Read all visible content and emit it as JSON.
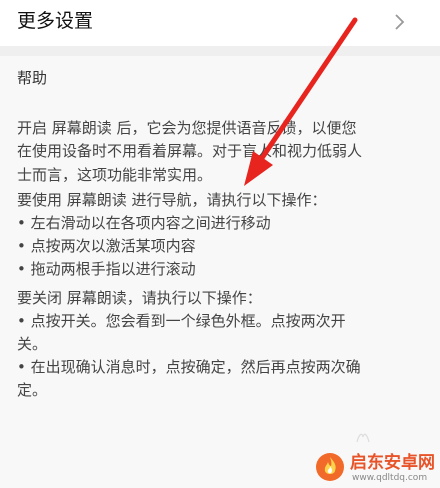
{
  "header": {
    "title": "更多设置",
    "chevron_icon": "chevron-right-icon"
  },
  "help": {
    "title": "帮助",
    "intro_lines": [
      "开启 屏幕朗读 后，它会为您提供语音反馈，以便您",
      "在使用设备时不用看着屏幕。对于盲人和视力低弱人",
      "士而言，这项功能非常实用。"
    ],
    "usage_heading": "要使用 屏幕朗读 进行导航，请执行以下操作：",
    "usage_items": [
      "• 左右滑动以在各项内容之间进行移动",
      "• 点按两次以激活某项内容",
      "• 拖动两根手指以进行滚动"
    ],
    "off_heading": "要关闭 屏幕朗读，请执行以下操作：",
    "off_items": [
      [
        "• 点按开关。您会看到一个绿色外框。点按两次开",
        "关。"
      ],
      [
        "• 在出现确认消息时，点按确定，然后再点按两次确",
        "定。"
      ]
    ]
  },
  "annotation": {
    "arrow_color": "#e8241f"
  },
  "watermark": {
    "name": "启东安卓网",
    "url": "www.qdltdq.com",
    "logo_icon": "flame-logo-icon"
  }
}
